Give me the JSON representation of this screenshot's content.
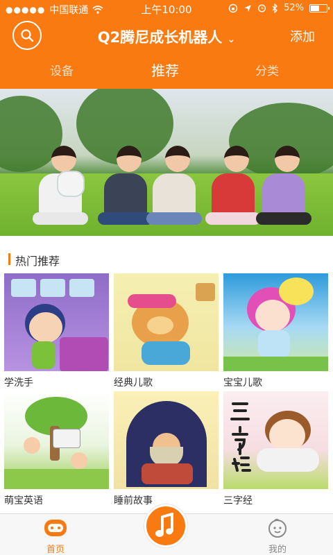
{
  "status_bar": {
    "carrier": "中国联通",
    "signal_dots": "●●●●●",
    "time": "上午10:00",
    "battery_percent": "52%",
    "battery_level": 0.52
  },
  "nav": {
    "title": "Q2腾尼成长机器人",
    "title_dropdown_glyph": "⌄",
    "add_label": "添加",
    "search_icon": "search-icon"
  },
  "tabs": [
    {
      "label": "设备",
      "active": false
    },
    {
      "label": "推荐",
      "active": true
    },
    {
      "label": "分类",
      "active": false
    }
  ],
  "section": {
    "title": "热门推荐"
  },
  "cards": [
    {
      "label": "学洗手"
    },
    {
      "label": "经典儿歌"
    },
    {
      "label": "宝宝儿歌"
    },
    {
      "label": "萌宝英语"
    },
    {
      "label": "睡前故事"
    },
    {
      "label": "三字经"
    }
  ],
  "tabbar": {
    "home_label": "首页",
    "mine_label": "我的",
    "center_icon": "music-note-icon"
  },
  "colors": {
    "brand": "#fa7a12",
    "text": "#333333",
    "tab_inactive": "#888888"
  }
}
